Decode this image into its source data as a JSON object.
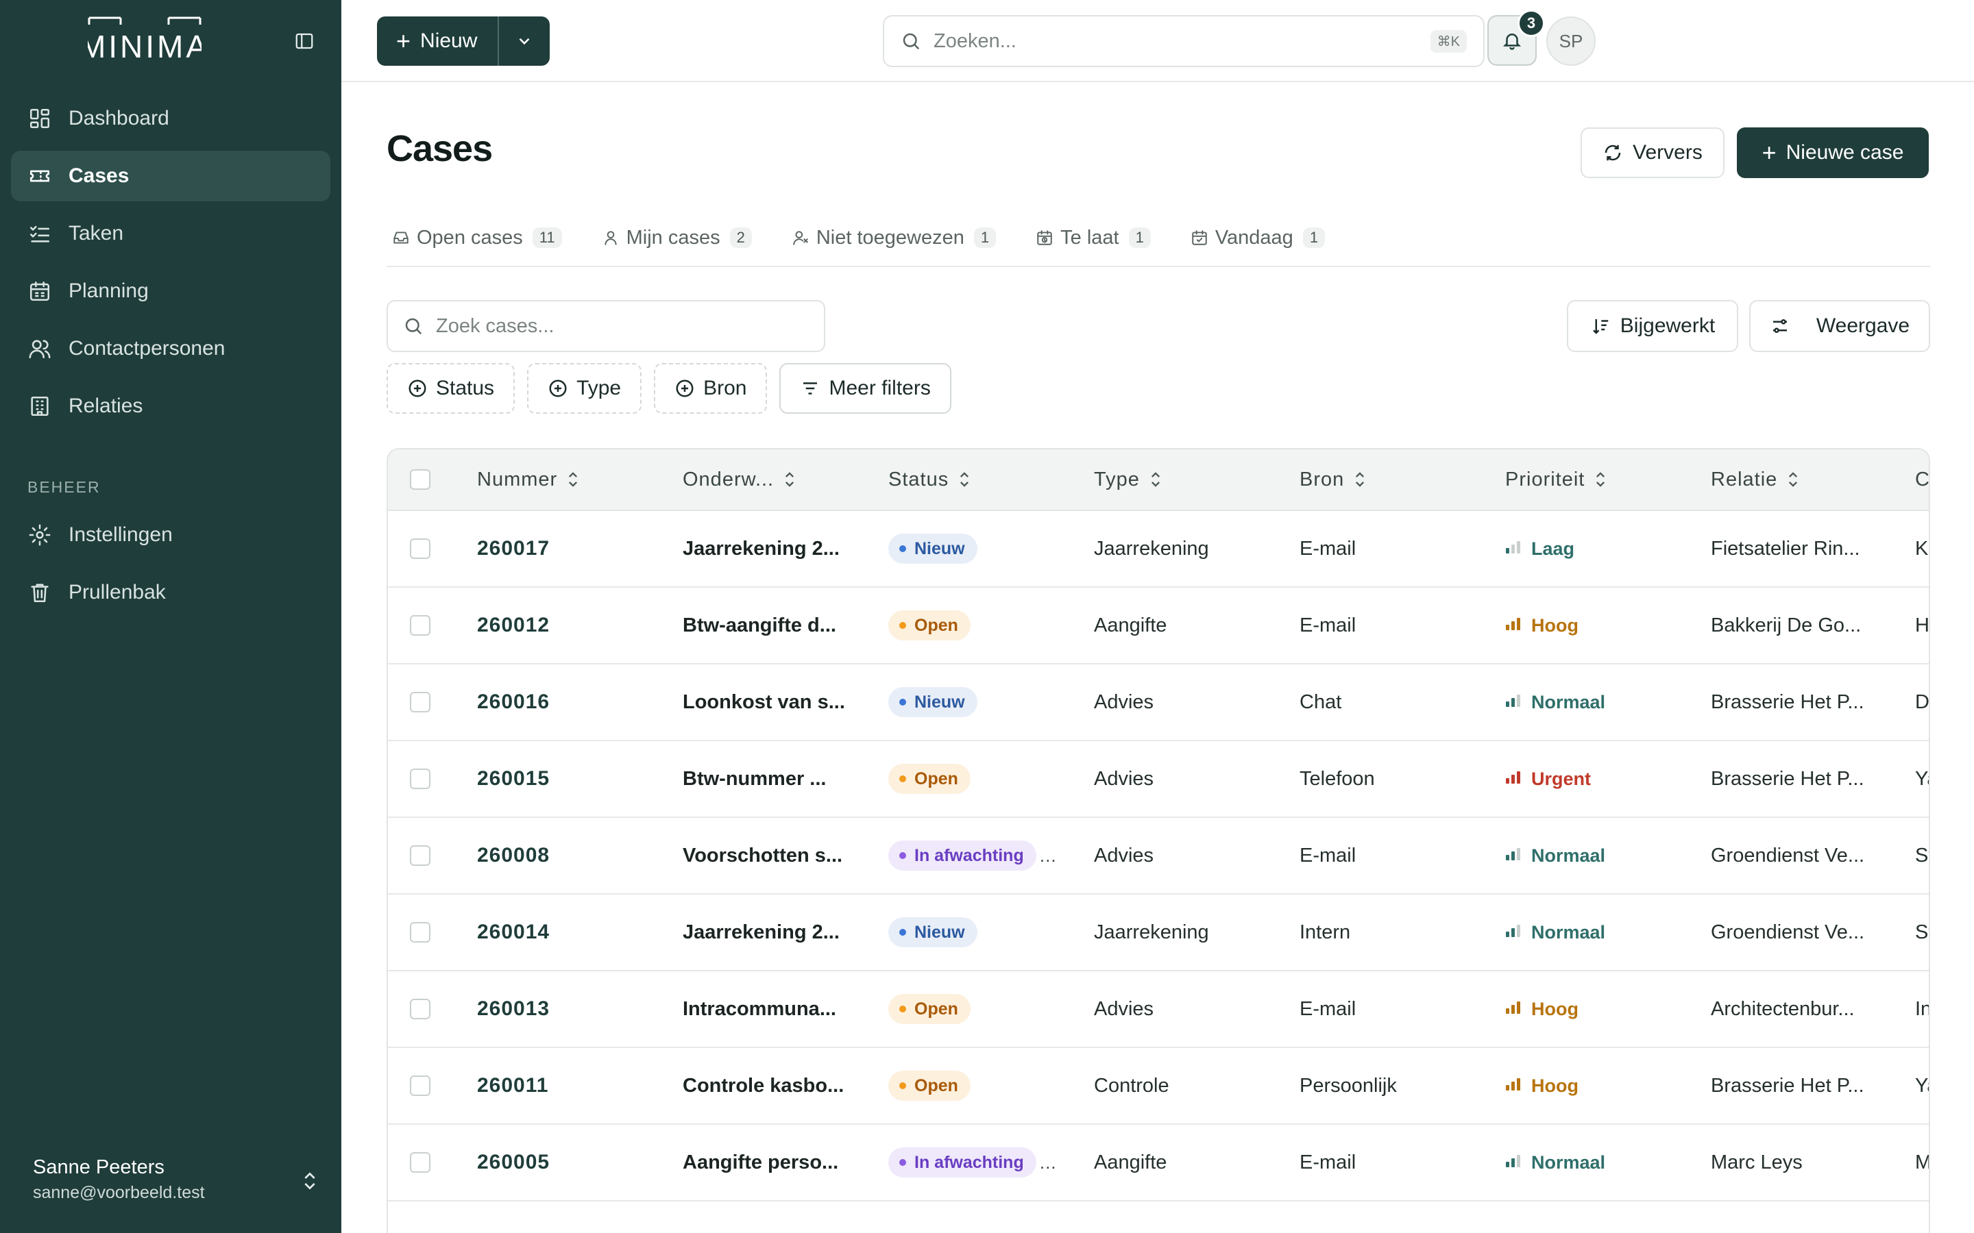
{
  "logo_text": "MINIMA",
  "sidebar": {
    "nav": [
      {
        "label": "Dashboard",
        "icon": "dashboard-icon",
        "active": false
      },
      {
        "label": "Cases",
        "icon": "ticket-icon",
        "active": true
      },
      {
        "label": "Taken",
        "icon": "tasks-icon",
        "active": false
      },
      {
        "label": "Planning",
        "icon": "calendar-icon",
        "active": false
      },
      {
        "label": "Contactpersonen",
        "icon": "users-icon",
        "active": false
      },
      {
        "label": "Relaties",
        "icon": "building-icon",
        "active": false
      }
    ],
    "section_label": "BEHEER",
    "manage": [
      {
        "label": "Instellingen",
        "icon": "gear-icon"
      },
      {
        "label": "Prullenbak",
        "icon": "trash-icon"
      }
    ],
    "user": {
      "name": "Sanne Peeters",
      "email": "sanne@voorbeeld.test"
    }
  },
  "topbar": {
    "new_label": "Nieuw",
    "search_placeholder": "Zoeken...",
    "search_shortcut": "⌘K",
    "notification_count": "3",
    "avatar_initials": "SP"
  },
  "page": {
    "title": "Cases",
    "refresh_label": "Ververs",
    "new_case_label": "Nieuwe case"
  },
  "tabs": [
    {
      "label": "Open cases",
      "count": "11",
      "icon": "inbox-icon"
    },
    {
      "label": "Mijn cases",
      "count": "2",
      "icon": "user-icon"
    },
    {
      "label": "Niet toegewezen",
      "count": "1",
      "icon": "user-x-icon"
    },
    {
      "label": "Te laat",
      "count": "1",
      "icon": "calendar-clock-icon"
    },
    {
      "label": "Vandaag",
      "count": "1",
      "icon": "calendar-check-icon"
    }
  ],
  "toolbar": {
    "case_search_placeholder": "Zoek cases...",
    "sort_label": "Bijgewerkt",
    "view_label": "Weergave",
    "filters": [
      "Status",
      "Type",
      "Bron",
      "Meer filters"
    ]
  },
  "table": {
    "columns": [
      "Nummer",
      "Onderw...",
      "Status",
      "Type",
      "Bron",
      "Prioriteit",
      "Relatie",
      "C"
    ],
    "rows": [
      {
        "nummer": "260017",
        "onderwerp": "Jaarrekening 2...",
        "status": "Nieuw",
        "type": "Jaarrekening",
        "bron": "E-mail",
        "prioriteit": "Laag",
        "relatie": "Fietsatelier Rin...",
        "extra": "K"
      },
      {
        "nummer": "260012",
        "onderwerp": "Btw-aangifte d...",
        "status": "Open",
        "type": "Aangifte",
        "bron": "E-mail",
        "prioriteit": "Hoog",
        "relatie": "Bakkerij De Go...",
        "extra": "H"
      },
      {
        "nummer": "260016",
        "onderwerp": "Loonkost van s...",
        "status": "Nieuw",
        "type": "Advies",
        "bron": "Chat",
        "prioriteit": "Normaal",
        "relatie": "Brasserie Het P...",
        "extra": "D"
      },
      {
        "nummer": "260015",
        "onderwerp": "Btw-nummer ...",
        "status": "Open",
        "type": "Advies",
        "bron": "Telefoon",
        "prioriteit": "Urgent",
        "relatie": "Brasserie Het P...",
        "extra": "Ya"
      },
      {
        "nummer": "260008",
        "onderwerp": "Voorschotten s...",
        "status": "In afwachting",
        "type": "Advies",
        "bron": "E-mail",
        "prioriteit": "Normaal",
        "relatie": "Groendienst Ve...",
        "extra": "St"
      },
      {
        "nummer": "260014",
        "onderwerp": "Jaarrekening 2...",
        "status": "Nieuw",
        "type": "Jaarrekening",
        "bron": "Intern",
        "prioriteit": "Normaal",
        "relatie": "Groendienst Ve...",
        "extra": "St"
      },
      {
        "nummer": "260013",
        "onderwerp": "Intracommuna...",
        "status": "Open",
        "type": "Advies",
        "bron": "E-mail",
        "prioriteit": "Hoog",
        "relatie": "Architectenbur...",
        "extra": "In"
      },
      {
        "nummer": "260011",
        "onderwerp": "Controle kasbo...",
        "status": "Open",
        "type": "Controle",
        "bron": "Persoonlijk",
        "prioriteit": "Hoog",
        "relatie": "Brasserie Het P...",
        "extra": "Ya"
      },
      {
        "nummer": "260005",
        "onderwerp": "Aangifte perso...",
        "status": "In afwachting",
        "type": "Aangifte",
        "bron": "E-mail",
        "prioriteit": "Normaal",
        "relatie": "Marc Leys",
        "extra": "M"
      }
    ]
  },
  "colors": {
    "sidebar": "#1f3d3a",
    "accent": "#1f3d3a",
    "prio_laag": "#2f6f6a",
    "prio_normaal": "#2f6f6a",
    "prio_hoog": "#b8740f",
    "prio_urgent": "#c03a2b"
  }
}
